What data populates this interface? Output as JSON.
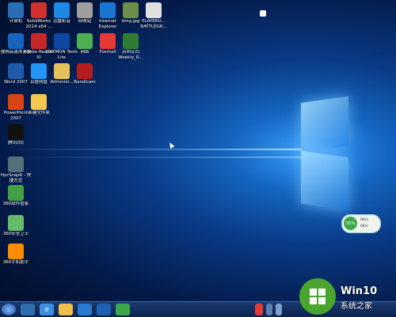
{
  "desktop": {
    "icons": [
      {
        "label": "计算机",
        "icon": "computer-icon",
        "color": "#2a6db5"
      },
      {
        "label": "SolidWorks 2014 x64 ...",
        "icon": "solidworks-icon",
        "color": "#d32f2f"
      },
      {
        "label": "迅雷影音",
        "icon": "xunlei-player-icon",
        "color": "#1e88e5"
      },
      {
        "label": "回收站",
        "icon": "recycle-bin-icon",
        "color": "#9e9e9e"
      },
      {
        "label": "Internet Explorer",
        "icon": "internet-explorer-icon",
        "color": "#1976d2"
      },
      {
        "label": "timg.jpg",
        "icon": "image-file-icon",
        "color": "#6d8f4a"
      },
      {
        "label": "PLAYERU... BATTLEGR...",
        "icon": "pubg-icon",
        "color": "#e0e0e0"
      },
      {
        "label": "搜狗高速浏览器",
        "icon": "sogou-browser-icon",
        "color": "#1565c0"
      },
      {
        "label": "Adobe Reader XI",
        "icon": "adobe-reader-icon",
        "color": "#c62828"
      },
      {
        "label": "DAEMON Tools Lite",
        "icon": "daemon-tools-icon",
        "color": "#0d47a1"
      },
      {
        "label": "网络",
        "icon": "network-icon",
        "color": "#4caf50"
      },
      {
        "label": "Foxmail",
        "icon": "foxmail-icon",
        "color": "#e53935"
      },
      {
        "label": "苏州公司 Weekly_R...",
        "icon": "excel-file-icon",
        "color": "#2e7d32"
      },
      {
        "label": "Word 2007",
        "icon": "word-icon",
        "color": "#1e5aa8"
      },
      {
        "label": "百度网盘",
        "icon": "baidu-netdisk-icon",
        "color": "#2196f3"
      },
      {
        "label": "Administ...",
        "icon": "user-folder-icon",
        "color": "#e6c15a"
      },
      {
        "label": "Bandicam",
        "icon": "bandicam-icon",
        "color": "#b71c1c"
      },
      {
        "label": "PowerPoint 2007",
        "icon": "powerpoint-icon",
        "color": "#d84315"
      },
      {
        "label": "新建文件夹",
        "icon": "folder-icon",
        "color": "#f2c94c"
      },
      {
        "label": "腾讯QQ",
        "icon": "qq-icon",
        "color": "#111111"
      },
      {
        "label": "HprSnap6 - 快捷方式",
        "icon": "hypersnap-icon",
        "color": "#546e7a"
      },
      {
        "label": "360软件管家",
        "icon": "360-software-manager-icon",
        "color": "#43a047"
      },
      {
        "label": "360安全卫士",
        "icon": "360-safe-icon",
        "color": "#66bb6a"
      },
      {
        "label": "360手机助手",
        "icon": "360-phone-assistant-icon",
        "color": "#fb8c00"
      }
    ]
  },
  "meter": {
    "percent": "35%",
    "up": "0K/s",
    "down": "0K/s"
  },
  "watermark": {
    "brand": "Win10",
    "sub": "系统之家"
  },
  "taskbar": {
    "items": [
      "start-orb-icon",
      "360-taskbar-icon",
      "internet-explorer-icon",
      "file-explorer-icon",
      "sogou-browser-icon",
      "media-player-icon",
      "360-browser-icon"
    ],
    "tray": [
      "sogou-input-icon",
      "chinese-ime-icon",
      "volume-icon",
      "network-tray-icon"
    ]
  }
}
